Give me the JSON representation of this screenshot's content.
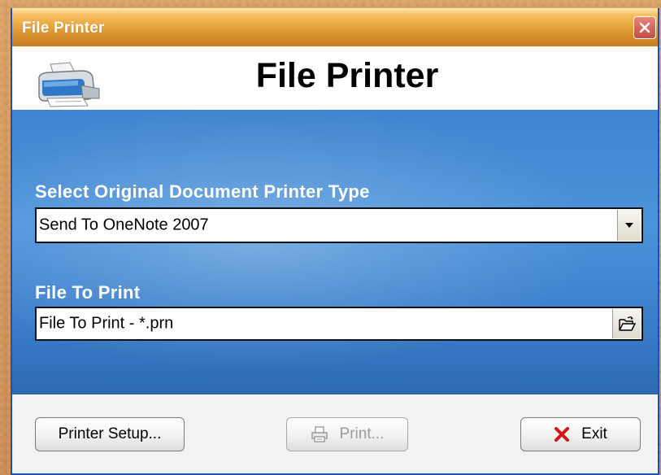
{
  "window": {
    "title": "File Printer"
  },
  "header": {
    "app_title": "File Printer",
    "icon": "printer-icon"
  },
  "form": {
    "printer_type": {
      "label": "Select Original Document Printer Type",
      "value": "Send To OneNote 2007"
    },
    "file_to_print": {
      "label": "File To Print",
      "value": "File To Print - *.prn"
    }
  },
  "buttons": {
    "printer_setup": "Printer Setup...",
    "print": "Print...",
    "exit": "Exit"
  },
  "colors": {
    "title_bar": "#e8a840",
    "panel_blue": "#4b93db",
    "close_red": "#c44f44",
    "border_blue": "#1f4fb0"
  }
}
